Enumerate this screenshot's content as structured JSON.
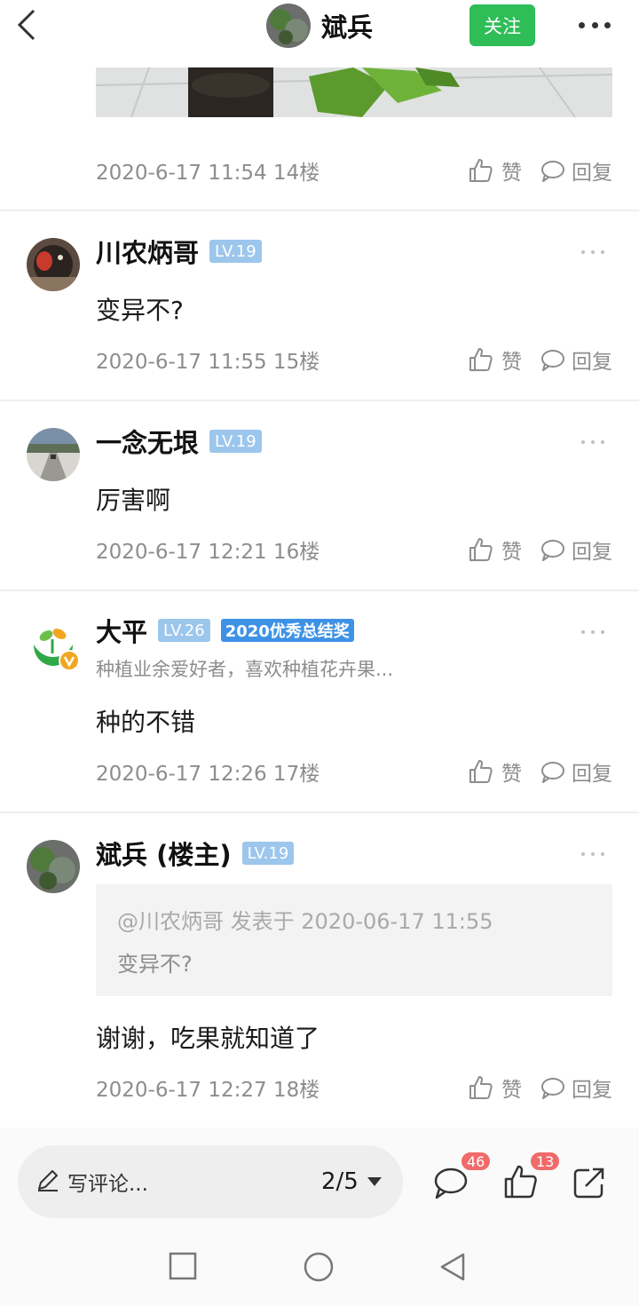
{
  "header": {
    "author_name": "斌兵",
    "follow_label": "关注"
  },
  "floor14": {
    "meta": "2020-6-17 11:54  14楼"
  },
  "actions": {
    "like_label": "赞",
    "reply_label": "回复"
  },
  "comments": [
    {
      "name": "川农炳哥",
      "level": "LV.19",
      "body": "变异不?",
      "meta": "2020-6-17 11:55  15楼"
    },
    {
      "name": "一念无垠",
      "level": "LV.19",
      "body": "厉害啊",
      "meta": "2020-6-17 12:21  16楼"
    },
    {
      "name": "大平",
      "level": "LV.26",
      "award": "2020优秀总结奖",
      "bio": "种植业余爱好者，喜欢种植花卉果...",
      "body": "种的不错",
      "meta": "2020-6-17 12:26  17楼"
    },
    {
      "name": "斌兵 (楼主)",
      "level": "LV.19",
      "quote_meta": "@川农炳哥 发表于 2020-06-17 11:55",
      "quote_text": "变异不?",
      "body": "谢谢，吃果就知道了",
      "meta": "2020-6-17 12:27  18楼"
    }
  ],
  "bottom_bar": {
    "comment_placeholder": "写评论...",
    "page": "2/5",
    "comment_count": "46",
    "like_count": "13"
  },
  "icons": {
    "back": "chevron-left-icon",
    "more": "more-dots-icon",
    "like": "thumbs-up-icon",
    "reply": "speech-bubble-icon",
    "pen": "pen-icon",
    "share": "share-icon"
  },
  "colors": {
    "follow_green": "#2fbd57",
    "level_badge": "#9cc6ec",
    "award_badge": "#3d92e6",
    "count_badge": "#f06a6a"
  }
}
